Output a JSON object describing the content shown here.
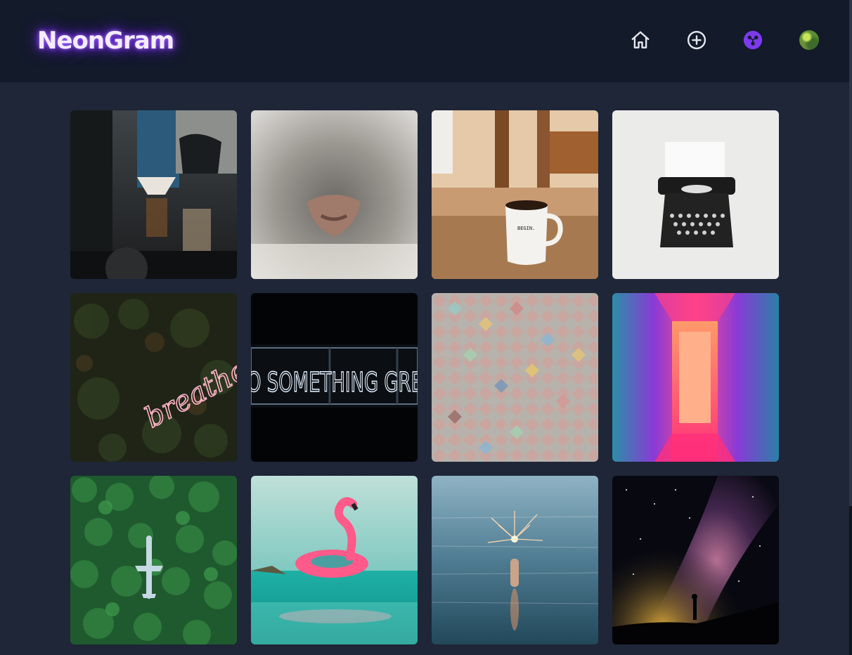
{
  "app": {
    "brand": "NeonGram"
  },
  "nav": [
    {
      "name": "home-icon",
      "label": "Home"
    },
    {
      "name": "add-post-icon",
      "label": "Create"
    },
    {
      "name": "explore-icon",
      "label": "Explore",
      "active": true,
      "active_color": "#7c3aed"
    },
    {
      "name": "profile-avatar",
      "label": "Profile"
    }
  ],
  "feed": {
    "posts": [
      {
        "subject": "coffee-bar"
      },
      {
        "subject": "cat-nose"
      },
      {
        "subject": "coffee-mug",
        "mug_text": "BEGIN."
      },
      {
        "subject": "typewriter"
      },
      {
        "subject": "neon-breathe",
        "neon_text": "breathe"
      },
      {
        "subject": "neon-sign",
        "neon_text": "O SOMETHING GRE"
      },
      {
        "subject": "colorful-tiles"
      },
      {
        "subject": "neon-corridor"
      },
      {
        "subject": "forest-airplane"
      },
      {
        "subject": "flamingo-float"
      },
      {
        "subject": "sparkler-sea"
      },
      {
        "subject": "milky-way"
      }
    ]
  },
  "colors": {
    "background": "#1e2637",
    "header": "#131a2a",
    "brand_glow": "#7b2cff",
    "icon": "#e6e8ef"
  }
}
